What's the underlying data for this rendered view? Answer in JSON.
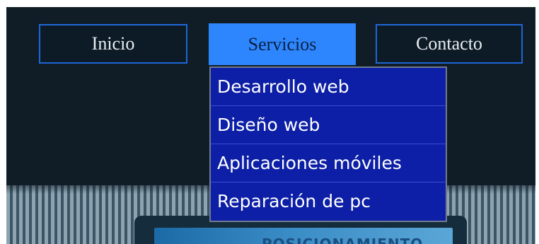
{
  "nav": {
    "items": [
      {
        "label": "Inicio"
      },
      {
        "label": "Servicios"
      },
      {
        "label": "Contacto"
      }
    ]
  },
  "dropdown": {
    "items": [
      {
        "label": "Desarrollo web"
      },
      {
        "label": "Diseño web"
      },
      {
        "label": "Aplicaciones móviles"
      },
      {
        "label": "Reparación de pc"
      }
    ]
  },
  "banner": {
    "text": "POSICIONAMIENTO"
  }
}
